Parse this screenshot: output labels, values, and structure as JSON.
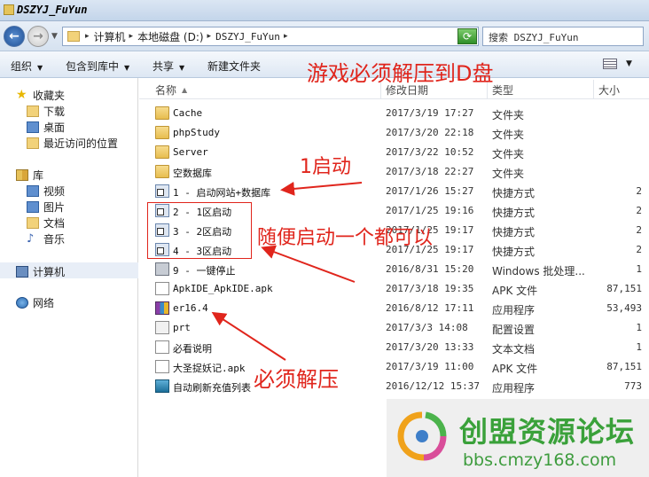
{
  "window": {
    "title": "DSZYJ_FuYun"
  },
  "address": {
    "breadcrumbs": [
      "计算机",
      "本地磁盘 (D:)",
      "DSZYJ_FuYun"
    ],
    "search_placeholder": "搜索 DSZYJ_FuYun"
  },
  "toolbar": {
    "organize": "组织",
    "include_library": "包含到库中",
    "share": "共享",
    "new_folder": "新建文件夹"
  },
  "nav": {
    "favorites": "收藏夹",
    "downloads": "下载",
    "desktop": "桌面",
    "recent": "最近访问的位置",
    "libraries": "库",
    "videos": "视频",
    "pictures": "图片",
    "documents": "文档",
    "music": "音乐",
    "computer": "计算机",
    "network": "网络"
  },
  "columns": {
    "name": "名称",
    "date": "修改日期",
    "type": "类型",
    "size": "大小"
  },
  "files": [
    {
      "icon": "folder-icon",
      "name": "Cache",
      "date": "2017/3/19 17:27",
      "type": "文件夹",
      "size": ""
    },
    {
      "icon": "folder-icon",
      "name": "phpStudy",
      "date": "2017/3/20 22:18",
      "type": "文件夹",
      "size": ""
    },
    {
      "icon": "folder-icon",
      "name": "Server",
      "date": "2017/3/22 10:52",
      "type": "文件夹",
      "size": ""
    },
    {
      "icon": "folder-icon",
      "name": "空数据库",
      "date": "2017/3/18 22:27",
      "type": "文件夹",
      "size": ""
    },
    {
      "icon": "shortcut-icon",
      "name": "1 - 启动网站+数据库",
      "date": "2017/1/26 15:27",
      "type": "快捷方式",
      "size": "2"
    },
    {
      "icon": "shortcut-icon",
      "name": "2 - 1区启动",
      "date": "2017/1/25 19:16",
      "type": "快捷方式",
      "size": "2"
    },
    {
      "icon": "shortcut-icon",
      "name": "3 - 2区启动",
      "date": "2017/1/25 19:17",
      "type": "快捷方式",
      "size": "2"
    },
    {
      "icon": "shortcut-icon",
      "name": "4 - 3区启动",
      "date": "2017/1/25 19:17",
      "type": "快捷方式",
      "size": "2"
    },
    {
      "icon": "batch-file-icon",
      "name": "9 - 一键停止",
      "date": "2016/8/31 15:20",
      "type": "Windows 批处理...",
      "size": "1"
    },
    {
      "icon": "document-icon",
      "name": "ApkIDE_ApkIDE.apk",
      "date": "2017/3/18 19:35",
      "type": "APK 文件",
      "size": "87,151"
    },
    {
      "icon": "archive-exe-icon",
      "name": "er16.4",
      "date": "2016/8/12 17:11",
      "type": "应用程序",
      "size": "53,493"
    },
    {
      "icon": "config-icon",
      "name": "prt",
      "date": "2017/3/3 14:08",
      "type": "配置设置",
      "size": "1"
    },
    {
      "icon": "text-file-icon",
      "name": "必看说明",
      "date": "2017/3/20 13:33",
      "type": "文本文档",
      "size": "1"
    },
    {
      "icon": "document-icon",
      "name": "大圣捉妖记.apk",
      "date": "2017/3/19 11:00",
      "type": "APK 文件",
      "size": "87,151"
    },
    {
      "icon": "app-icon",
      "name": "自动刷新充值列表",
      "date": "2016/12/12 15:37",
      "type": "应用程序",
      "size": "773"
    }
  ],
  "annotations": {
    "must_extract_d": "游戏必须解压到D盘",
    "start_one": "1启动",
    "start_any": "随便启动一个都可以",
    "must_extract": "必须解压",
    "color": "#e0251c"
  },
  "watermark": {
    "name": "创盟资源论坛",
    "url": "bbs.cmzy168.com"
  }
}
